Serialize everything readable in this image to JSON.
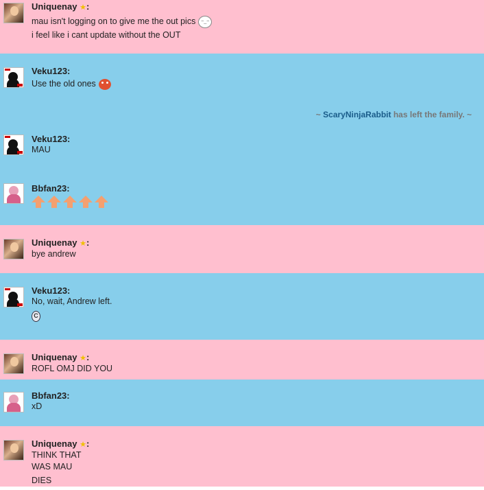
{
  "messages": [
    {
      "user": "Uniquenay",
      "lines": [
        "mau isn't logging on to give me the out pics",
        "i feel like i cant update without the OUT"
      ]
    },
    {
      "user": "Veku123:",
      "lines": [
        "Use the old ones"
      ]
    },
    {
      "system": {
        "prefix": "~ ",
        "who": "ScaryNinjaRabbit",
        "rest": " has left the family. ~"
      }
    },
    {
      "user": "Veku123:",
      "lines": [
        "MAU"
      ]
    },
    {
      "user": "Bbfan23:",
      "lines": []
    },
    {
      "user": "Uniquenay",
      "lines": [
        "bye andrew"
      ]
    },
    {
      "user": "Veku123:",
      "lines": [
        "No, wait, Andrew left."
      ]
    },
    {
      "user": "Uniquenay",
      "lines": [
        "ROFL OMJ DID YOU"
      ]
    },
    {
      "user": "Bbfan23:",
      "lines": [
        "xD"
      ]
    },
    {
      "user": "Uniquenay",
      "lines": [
        "THINK THAT",
        "WAS MAU",
        "DIES"
      ]
    }
  ],
  "badge": {
    "star": "★",
    "colon": ":"
  },
  "emoticons": {
    "smile_bubble": "~_~",
    "coin": "C"
  },
  "colors": {
    "pink": "#ffbfcf",
    "blue": "#87ceeb"
  }
}
